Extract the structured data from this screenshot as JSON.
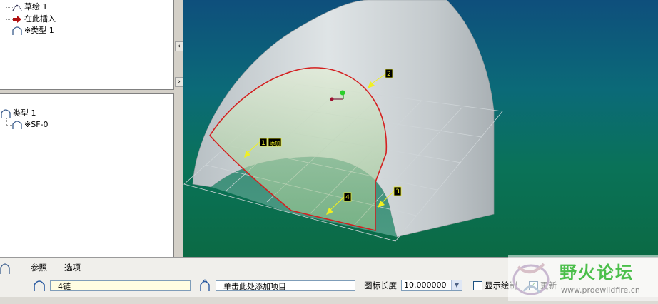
{
  "model_tree_top": {
    "items": [
      {
        "label": "草绘 1",
        "icon": "sketch-icon"
      },
      {
        "label": "在此插入",
        "icon": "insert-here-arrow-icon"
      },
      {
        "label": "※类型 1",
        "icon": "surface-type-icon"
      }
    ]
  },
  "model_tree_bottom": {
    "items": [
      {
        "label": "类型 1",
        "icon": "surface-type-icon"
      },
      {
        "label": "※SF-0",
        "icon": "surface-feature-icon"
      }
    ]
  },
  "splitter": {
    "collapse_left": "‹",
    "expand_right": "›"
  },
  "viewport": {
    "callouts": [
      "1",
      "2",
      "3",
      "4"
    ],
    "callout_1_tag": "添加",
    "colors": {
      "surface": "#cfd6d8",
      "edge": "#d42020",
      "highlight": "#9cc79a",
      "sketch_plane": "#b0b8c0"
    }
  },
  "dashboard": {
    "tabs": [
      "参照",
      "选项"
    ],
    "chain_field": "4链",
    "add_item_placeholder": "单击此处添加项目",
    "icon_length_label": "图标长度",
    "icon_length_value": "10.000000",
    "show_draw_label": "显示绘制",
    "show_draw_checked": false,
    "update_label": "更新",
    "update_checked": true
  },
  "watermark": {
    "title": "野火论坛",
    "url": "www.proewildfire.cn"
  }
}
